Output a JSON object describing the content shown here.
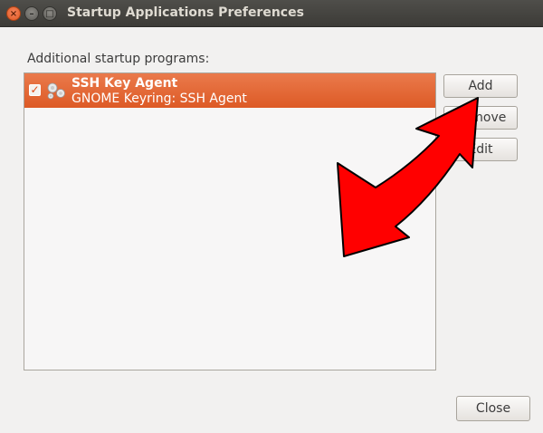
{
  "window": {
    "title": "Startup Applications Preferences"
  },
  "section": {
    "label": "Additional startup programs:"
  },
  "programs": [
    {
      "name": "SSH Key Agent",
      "description": "GNOME Keyring: SSH Agent",
      "enabled": true,
      "icon": "gears-icon"
    }
  ],
  "buttons": {
    "add": "Add",
    "remove": "Remove",
    "edit": "Edit",
    "close": "Close"
  },
  "colors": {
    "accent": "#dd5a26",
    "arrow": "#ff0000"
  }
}
